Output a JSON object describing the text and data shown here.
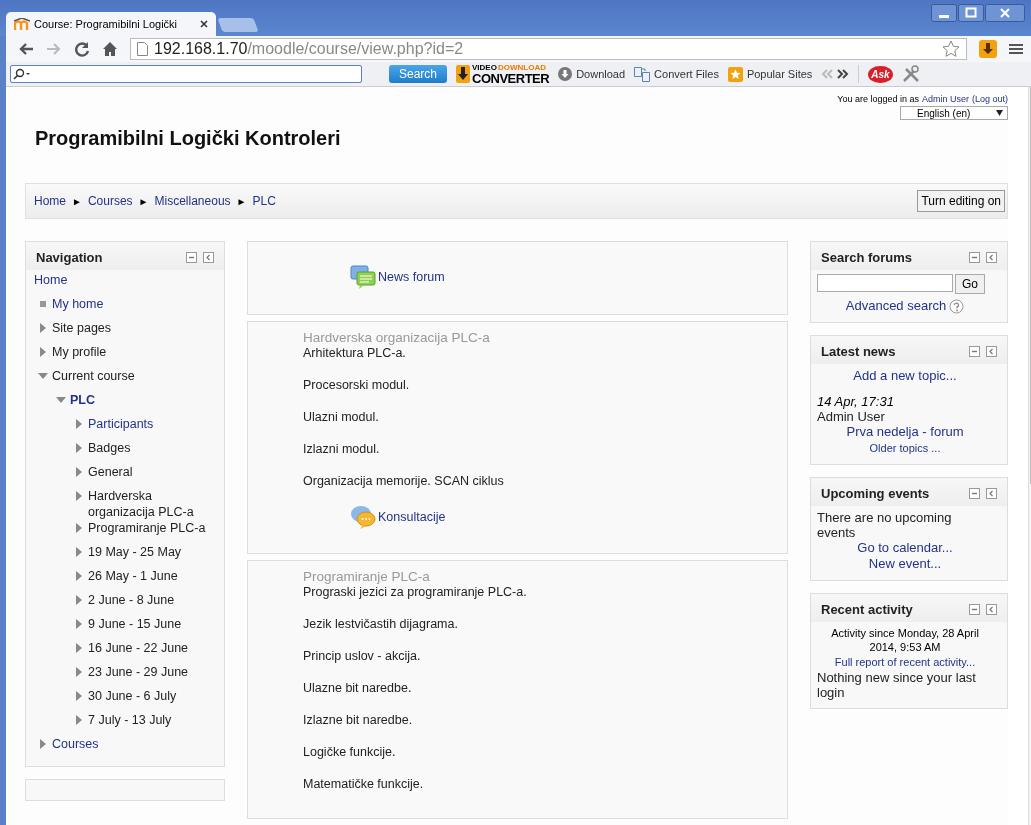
{
  "browser": {
    "tab_title": "Course: Programibilni Logički",
    "url_host": "192.168.1.70",
    "url_path": "/moodle/course/view.php?id=2"
  },
  "toolbar": {
    "search_button": "Search",
    "logo_top": "VIDEO",
    "logo_small": "DOWNLOAD",
    "logo_main": "CONVERTER",
    "items": [
      {
        "kind": "download",
        "label": "Download"
      },
      {
        "kind": "convert",
        "label": "Convert Files"
      },
      {
        "kind": "popular",
        "label": "Popular Sites"
      }
    ],
    "ask_logo": "Ask"
  },
  "header": {
    "title": "Programibilni Logički Kontroleri",
    "login_prefix": "You are logged in as",
    "user": "Admin User",
    "logout": "(Log out)",
    "language": "English (en)"
  },
  "breadcrumb": {
    "separator": "►",
    "items": [
      "Home",
      "Courses",
      "Miscellaneous",
      "PLC"
    ]
  },
  "edit_button": "Turn editing on",
  "navigation": {
    "title": "Navigation",
    "items": [
      {
        "label": "Home",
        "kind": "root",
        "link": true
      },
      {
        "label": "My home",
        "kind": "bullet",
        "link": true
      },
      {
        "label": "Site pages",
        "kind": "collapsed",
        "link": false
      },
      {
        "label": "My profile",
        "kind": "collapsed",
        "link": false
      },
      {
        "label": "Current course",
        "kind": "expanded",
        "link": false,
        "children": [
          {
            "label": "PLC",
            "kind": "current",
            "link": true,
            "children": [
              {
                "label": "Participants",
                "kind": "collapsed",
                "link": true
              },
              {
                "label": "Badges",
                "kind": "collapsed",
                "link": false
              },
              {
                "label": "General",
                "kind": "collapsed",
                "link": false
              },
              {
                "label": "Hardverska organizacija PLC-a",
                "kind": "collapsed",
                "link": false
              },
              {
                "label": "Programiranje PLC-a",
                "kind": "collapsed",
                "link": false
              },
              {
                "label": "19 May - 25 May",
                "kind": "collapsed",
                "link": false
              },
              {
                "label": "26 May - 1 June",
                "kind": "collapsed",
                "link": false
              },
              {
                "label": "2 June - 8 June",
                "kind": "collapsed",
                "link": false
              },
              {
                "label": "9 June - 15 June",
                "kind": "collapsed",
                "link": false
              },
              {
                "label": "16 June - 22 June",
                "kind": "collapsed",
                "link": false
              },
              {
                "label": "23 June - 29 June",
                "kind": "collapsed",
                "link": false
              },
              {
                "label": "30 June - 6 July",
                "kind": "collapsed",
                "link": false
              },
              {
                "label": "7 July - 13 July",
                "kind": "collapsed",
                "link": false
              }
            ]
          }
        ]
      },
      {
        "label": "Courses",
        "kind": "collapsed",
        "link": true
      }
    ]
  },
  "sections": [
    {
      "items": [
        {
          "kind": "forum",
          "label": "News forum"
        }
      ]
    },
    {
      "title": "Hardverska organizacija PLC-a",
      "items": [
        {
          "kind": "text",
          "text": "Arhitektura PLC-a."
        },
        {
          "kind": "text",
          "text": "Procesorski modul."
        },
        {
          "kind": "text",
          "text": "Ulazni modul."
        },
        {
          "kind": "text",
          "text": "Izlazni modul."
        },
        {
          "kind": "text",
          "text": "Organizacija memorije. SCAN ciklus"
        },
        {
          "kind": "chat",
          "label": "Konsultacije"
        }
      ]
    },
    {
      "title": "Programiranje PLC-a",
      "items": [
        {
          "kind": "text",
          "text": "Prograski jezici za programiranje PLC-a."
        },
        {
          "kind": "text",
          "text": "Jezik lestvičastih dijagrama."
        },
        {
          "kind": "text",
          "text": "Princip uslov - akcija."
        },
        {
          "kind": "text",
          "text": "Ulazne bit naredbe."
        },
        {
          "kind": "text",
          "text": "Izlazne bit naredbe."
        },
        {
          "kind": "text",
          "text": "Logičke funkcije."
        },
        {
          "kind": "text",
          "text": "Matematičke funkcije."
        }
      ]
    }
  ],
  "blocks": [
    {
      "title": "Search forums",
      "lines": [
        {
          "kind": "search",
          "text": "Go"
        },
        {
          "kind": "help-link",
          "text": "Advanced search"
        }
      ]
    },
    {
      "title": "Latest news",
      "lines": [
        {
          "kind": "link",
          "text": "Add a new topic..."
        },
        {
          "kind": "date",
          "text": "14 Apr, 17:31"
        },
        {
          "kind": "text",
          "text": "Admin User"
        },
        {
          "kind": "link",
          "text": "Prva nedelja - forum"
        },
        {
          "kind": "small-link",
          "text": "Older topics ..."
        }
      ]
    },
    {
      "title": "Upcoming events",
      "lines": [
        {
          "kind": "text",
          "text": "There are no upcoming events"
        },
        {
          "kind": "link",
          "text": "Go to calendar..."
        },
        {
          "kind": "link",
          "text": "New event..."
        }
      ]
    },
    {
      "title": "Recent activity",
      "lines": [
        {
          "kind": "note",
          "text": "Activity since Monday, 28 April 2014, 9:53 AM"
        },
        {
          "kind": "small-link",
          "text": "Full report of recent activity..."
        },
        {
          "kind": "text",
          "text": "Nothing new since your last login"
        }
      ]
    }
  ]
}
